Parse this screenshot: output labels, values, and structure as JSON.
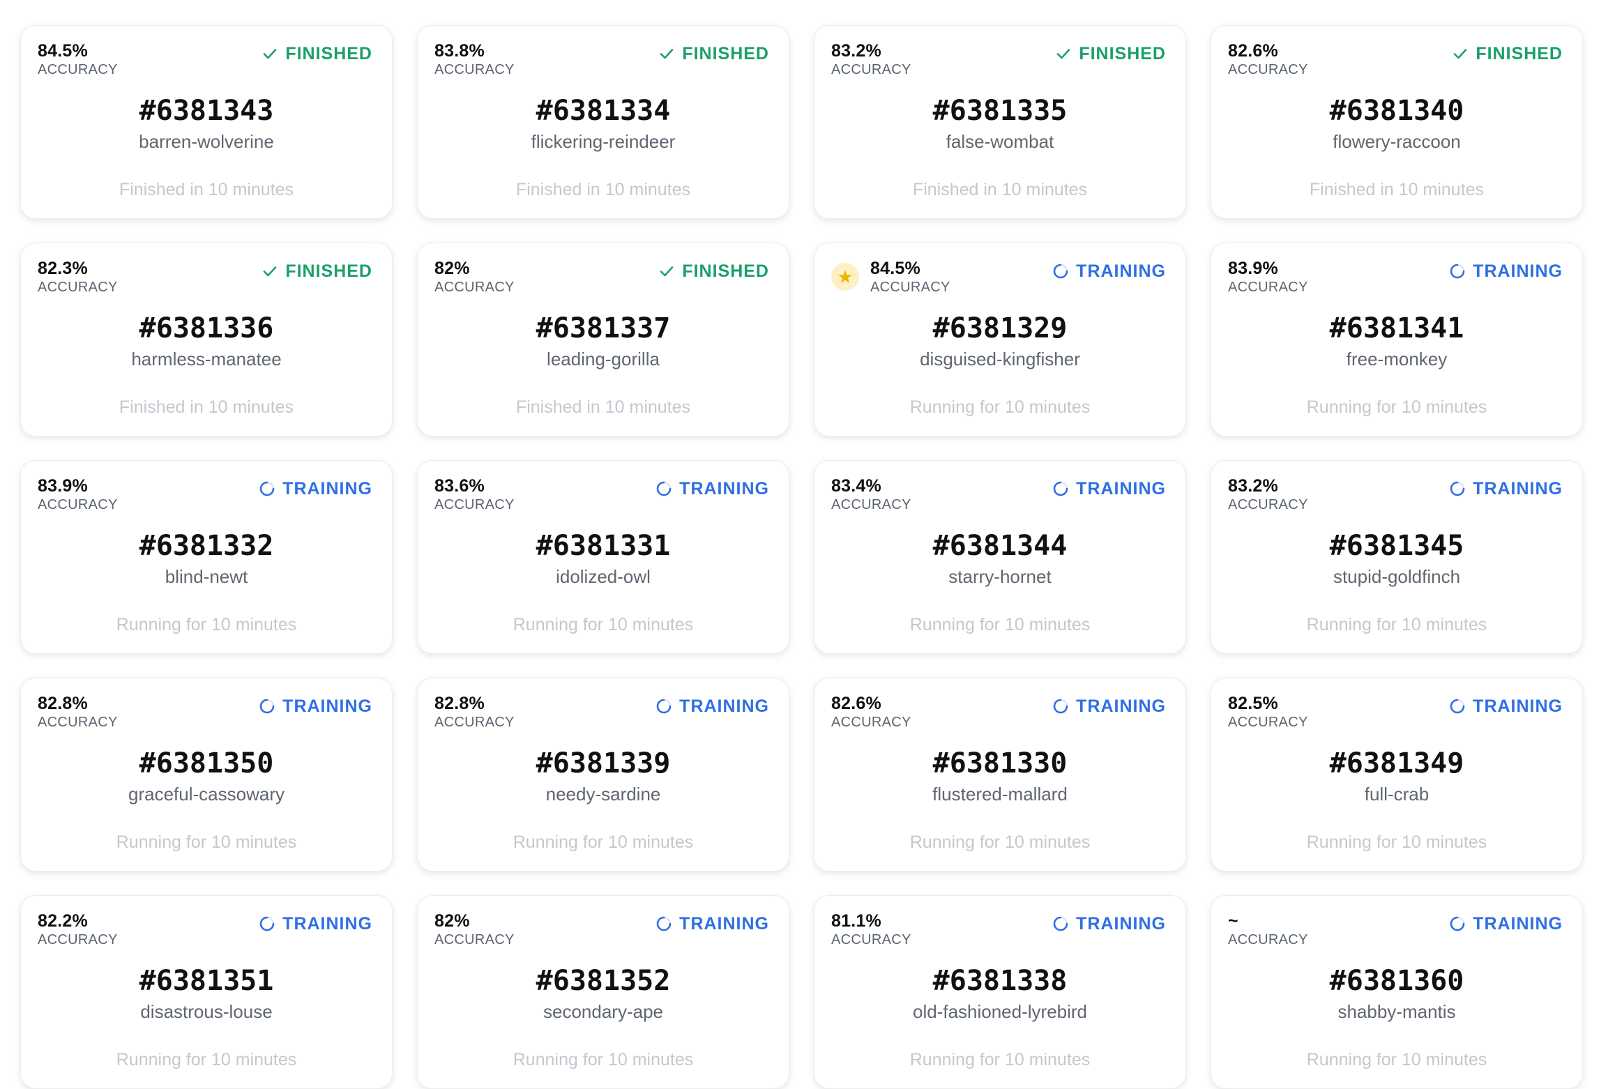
{
  "colors": {
    "finished": "#1aa06a",
    "training": "#2f6fe4",
    "star": "#f0b400",
    "card_border": "#ececec"
  },
  "icons": {
    "finished": "check-icon",
    "training": "spinner-icon",
    "starred": "star-icon"
  },
  "accuracy_label": "ACCURACY",
  "runs": [
    {
      "accuracy": "84.5%",
      "status": "FINISHED",
      "id": "#6381343",
      "name": "barren-wolverine",
      "time": "Finished in 10 minutes",
      "starred": false
    },
    {
      "accuracy": "83.8%",
      "status": "FINISHED",
      "id": "#6381334",
      "name": "flickering-reindeer",
      "time": "Finished in 10 minutes",
      "starred": false
    },
    {
      "accuracy": "83.2%",
      "status": "FINISHED",
      "id": "#6381335",
      "name": "false-wombat",
      "time": "Finished in 10 minutes",
      "starred": false
    },
    {
      "accuracy": "82.6%",
      "status": "FINISHED",
      "id": "#6381340",
      "name": "flowery-raccoon",
      "time": "Finished in 10 minutes",
      "starred": false
    },
    {
      "accuracy": "82.3%",
      "status": "FINISHED",
      "id": "#6381336",
      "name": "harmless-manatee",
      "time": "Finished in 10 minutes",
      "starred": false
    },
    {
      "accuracy": "82%",
      "status": "FINISHED",
      "id": "#6381337",
      "name": "leading-gorilla",
      "time": "Finished in 10 minutes",
      "starred": false
    },
    {
      "accuracy": "84.5%",
      "status": "TRAINING",
      "id": "#6381329",
      "name": "disguised-kingfisher",
      "time": "Running for 10 minutes",
      "starred": true
    },
    {
      "accuracy": "83.9%",
      "status": "TRAINING",
      "id": "#6381341",
      "name": "free-monkey",
      "time": "Running for 10 minutes",
      "starred": false
    },
    {
      "accuracy": "83.9%",
      "status": "TRAINING",
      "id": "#6381332",
      "name": "blind-newt",
      "time": "Running for 10 minutes",
      "starred": false
    },
    {
      "accuracy": "83.6%",
      "status": "TRAINING",
      "id": "#6381331",
      "name": "idolized-owl",
      "time": "Running for 10 minutes",
      "starred": false
    },
    {
      "accuracy": "83.4%",
      "status": "TRAINING",
      "id": "#6381344",
      "name": "starry-hornet",
      "time": "Running for 10 minutes",
      "starred": false
    },
    {
      "accuracy": "83.2%",
      "status": "TRAINING",
      "id": "#6381345",
      "name": "stupid-goldfinch",
      "time": "Running for 10 minutes",
      "starred": false
    },
    {
      "accuracy": "82.8%",
      "status": "TRAINING",
      "id": "#6381350",
      "name": "graceful-cassowary",
      "time": "Running for 10 minutes",
      "starred": false
    },
    {
      "accuracy": "82.8%",
      "status": "TRAINING",
      "id": "#6381339",
      "name": "needy-sardine",
      "time": "Running for 10 minutes",
      "starred": false
    },
    {
      "accuracy": "82.6%",
      "status": "TRAINING",
      "id": "#6381330",
      "name": "flustered-mallard",
      "time": "Running for 10 minutes",
      "starred": false
    },
    {
      "accuracy": "82.5%",
      "status": "TRAINING",
      "id": "#6381349",
      "name": "full-crab",
      "time": "Running for 10 minutes",
      "starred": false
    },
    {
      "accuracy": "82.2%",
      "status": "TRAINING",
      "id": "#6381351",
      "name": "disastrous-louse",
      "time": "Running for 10 minutes",
      "starred": false
    },
    {
      "accuracy": "82%",
      "status": "TRAINING",
      "id": "#6381352",
      "name": "secondary-ape",
      "time": "Running for 10 minutes",
      "starred": false
    },
    {
      "accuracy": "81.1%",
      "status": "TRAINING",
      "id": "#6381338",
      "name": "old-fashioned-lyrebird",
      "time": "Running for 10 minutes",
      "starred": false
    },
    {
      "accuracy": "~",
      "status": "TRAINING",
      "id": "#6381360",
      "name": "shabby-mantis",
      "time": "Running for 10 minutes",
      "starred": false
    }
  ]
}
